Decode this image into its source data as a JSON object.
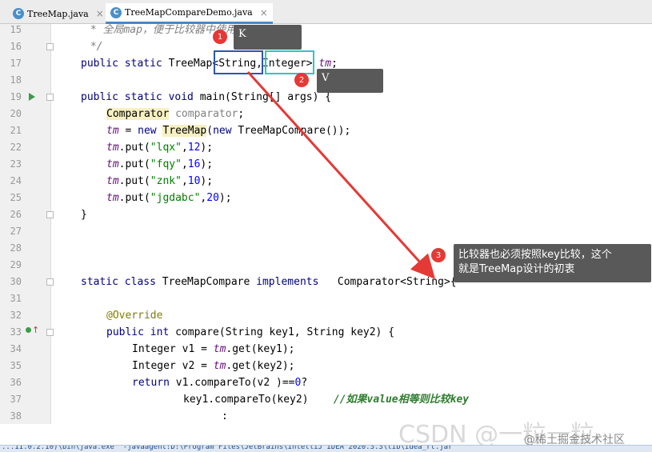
{
  "tabs": [
    {
      "label": "TreeMap.java",
      "icon": "C",
      "active": false
    },
    {
      "label": "TreeMapCompareDemo.java",
      "icon": "C",
      "active": true
    }
  ],
  "lines": {
    "l15": {
      "num": "15",
      "a": " * ",
      "b": "全局map，便于比较器中使用"
    },
    "l16": {
      "num": "16",
      "a": " */"
    },
    "l17": {
      "num": "17",
      "a": "public static ",
      "b": "TreeMap<String,Integer> ",
      "c": "tm",
      "d": ";"
    },
    "l18": {
      "num": "18"
    },
    "l19": {
      "num": "19",
      "a": "public static void ",
      "b": "main(String[] args) {"
    },
    "l20": {
      "num": "20",
      "a": "Comparator",
      "b": " comparator",
      "c": ";"
    },
    "l21": {
      "num": "21",
      "a": "tm",
      "b": " = ",
      "c": "new ",
      "d": "TreeMap",
      "e": "(",
      "f": "new ",
      "g": "TreeMapCompare());"
    },
    "l22": {
      "num": "22",
      "a": "tm",
      "b": ".put(",
      "c": "\"lqx\"",
      "d": ",",
      "e": "12",
      "f": ");"
    },
    "l23": {
      "num": "23",
      "a": "tm",
      "b": ".put(",
      "c": "\"fqy\"",
      "d": ",",
      "e": "16",
      "f": ");"
    },
    "l24": {
      "num": "24",
      "a": "tm",
      "b": ".put(",
      "c": "\"znk\"",
      "d": ",",
      "e": "10",
      "f": ");"
    },
    "l25": {
      "num": "25",
      "a": "tm",
      "b": ".put(",
      "c": "\"jgdabc\"",
      "d": ",",
      "e": "20",
      "f": ");"
    },
    "l26": {
      "num": "26",
      "a": "}"
    },
    "l27": {
      "num": "27"
    },
    "l28": {
      "num": "28"
    },
    "l29": {
      "num": "29"
    },
    "l30": {
      "num": "30",
      "a": "static class ",
      "b": "TreeMapCompare ",
      "c": "implements   ",
      "d": "Comparator<String>{"
    },
    "l31": {
      "num": "31"
    },
    "l32": {
      "num": "32",
      "a": "@Override"
    },
    "l33": {
      "num": "33",
      "a": "public int ",
      "b": "compare(String key1, String key2) {"
    },
    "l34": {
      "num": "34",
      "a": "Integer v1 = ",
      "b": "tm",
      "c": ".get(key1);"
    },
    "l35": {
      "num": "35",
      "a": "Integer v2 = ",
      "b": "tm",
      "c": ".get(key2);"
    },
    "l36": {
      "num": "36",
      "a": "return ",
      "b": "v1.compareTo(v2 )==",
      "c": "0",
      "d": "?"
    },
    "l37": {
      "num": "37",
      "a": "key1.compareTo(key2)    ",
      "b": "//如果value相等则比较key"
    },
    "l38": {
      "num": "38",
      "a": ":"
    }
  },
  "annotations": {
    "k": {
      "badge": "1",
      "label": "K",
      "color": "#2b57b3"
    },
    "v": {
      "badge": "2",
      "label": "V",
      "color": "#2fc4c9"
    },
    "note": {
      "badge": "3",
      "line1": "比较器也必须按照key比较，这个",
      "line2": "就是TreeMap设计的初衷"
    },
    "arrow_color": "#e53935"
  },
  "statusbar": {
    "text": "...11.0.2.10)\\bin\\java.exe \"-javaagent:D:\\Program Files\\JetBrains\\IntelliJ IDEA 2020.3.3\\lib\\idea_rt.jar"
  },
  "watermark": {
    "csdn": "CSDN @一粒一粒",
    "juejin": "@稀土掘金技术社区"
  }
}
